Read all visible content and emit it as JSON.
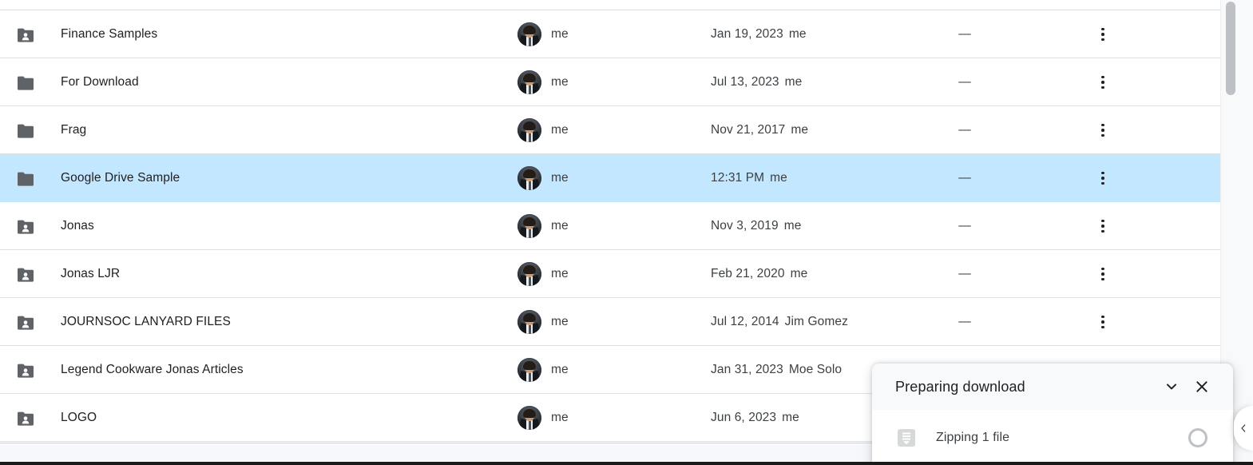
{
  "colors": {
    "selected_row_bg": "#c2e7ff",
    "divider": "#e0e0e0",
    "text_primary": "#202124",
    "text_secondary": "#3c4043",
    "folder_icon": "#5f6368",
    "panel_header_bg": "#f8f9fa",
    "footer_band": "#f6f8fc",
    "scrollbar_thumb": "#bdc1c6"
  },
  "file_list": {
    "size_empty": "—",
    "owner_label": "me",
    "rows": [
      {
        "name": "Finance Samples",
        "icon": "shared-folder-icon",
        "shared": true,
        "owner": "me",
        "date": "Jan 19, 2023",
        "modified_by": "me",
        "size": "—",
        "selected": false
      },
      {
        "name": "For Download",
        "icon": "folder-icon",
        "shared": false,
        "owner": "me",
        "date": "Jul 13, 2023",
        "modified_by": "me",
        "size": "—",
        "selected": false
      },
      {
        "name": "Frag",
        "icon": "folder-icon",
        "shared": false,
        "owner": "me",
        "date": "Nov 21, 2017",
        "modified_by": "me",
        "size": "—",
        "selected": false
      },
      {
        "name": "Google Drive Sample",
        "icon": "folder-icon",
        "shared": false,
        "owner": "me",
        "date": "12:31 PM",
        "modified_by": "me",
        "size": "—",
        "selected": true
      },
      {
        "name": "Jonas",
        "icon": "shared-folder-icon",
        "shared": true,
        "owner": "me",
        "date": "Nov 3, 2019",
        "modified_by": "me",
        "size": "—",
        "selected": false
      },
      {
        "name": "Jonas LJR",
        "icon": "shared-folder-icon",
        "shared": true,
        "owner": "me",
        "date": "Feb 21, 2020",
        "modified_by": "me",
        "size": "—",
        "selected": false
      },
      {
        "name": "JOURNSOC LANYARD FILES",
        "icon": "shared-folder-icon",
        "shared": true,
        "owner": "me",
        "date": "Jul 12, 2014",
        "modified_by": "Jim Gomez",
        "size": "—",
        "selected": false
      },
      {
        "name": "Legend Cookware Jonas Articles",
        "icon": "shared-folder-icon",
        "shared": true,
        "owner": "me",
        "date": "Jan 31, 2023",
        "modified_by": "Moe Solo",
        "size": "—",
        "selected": false
      },
      {
        "name": "LOGO",
        "icon": "shared-folder-icon",
        "shared": true,
        "owner": "me",
        "date": "Jun 6, 2023",
        "modified_by": "me",
        "size": "—",
        "selected": false
      }
    ]
  },
  "download_panel": {
    "title": "Preparing download",
    "collapse_icon": "chevron-down-icon",
    "close_icon": "close-icon",
    "item": {
      "icon": "zip-file-icon",
      "label": "Zipping 1 file",
      "status_icon": "progress-spinner-icon"
    }
  },
  "side_tab": {
    "icon": "chevron-left-icon"
  },
  "scrollbar": {
    "icon": "vertical-scrollbar"
  }
}
